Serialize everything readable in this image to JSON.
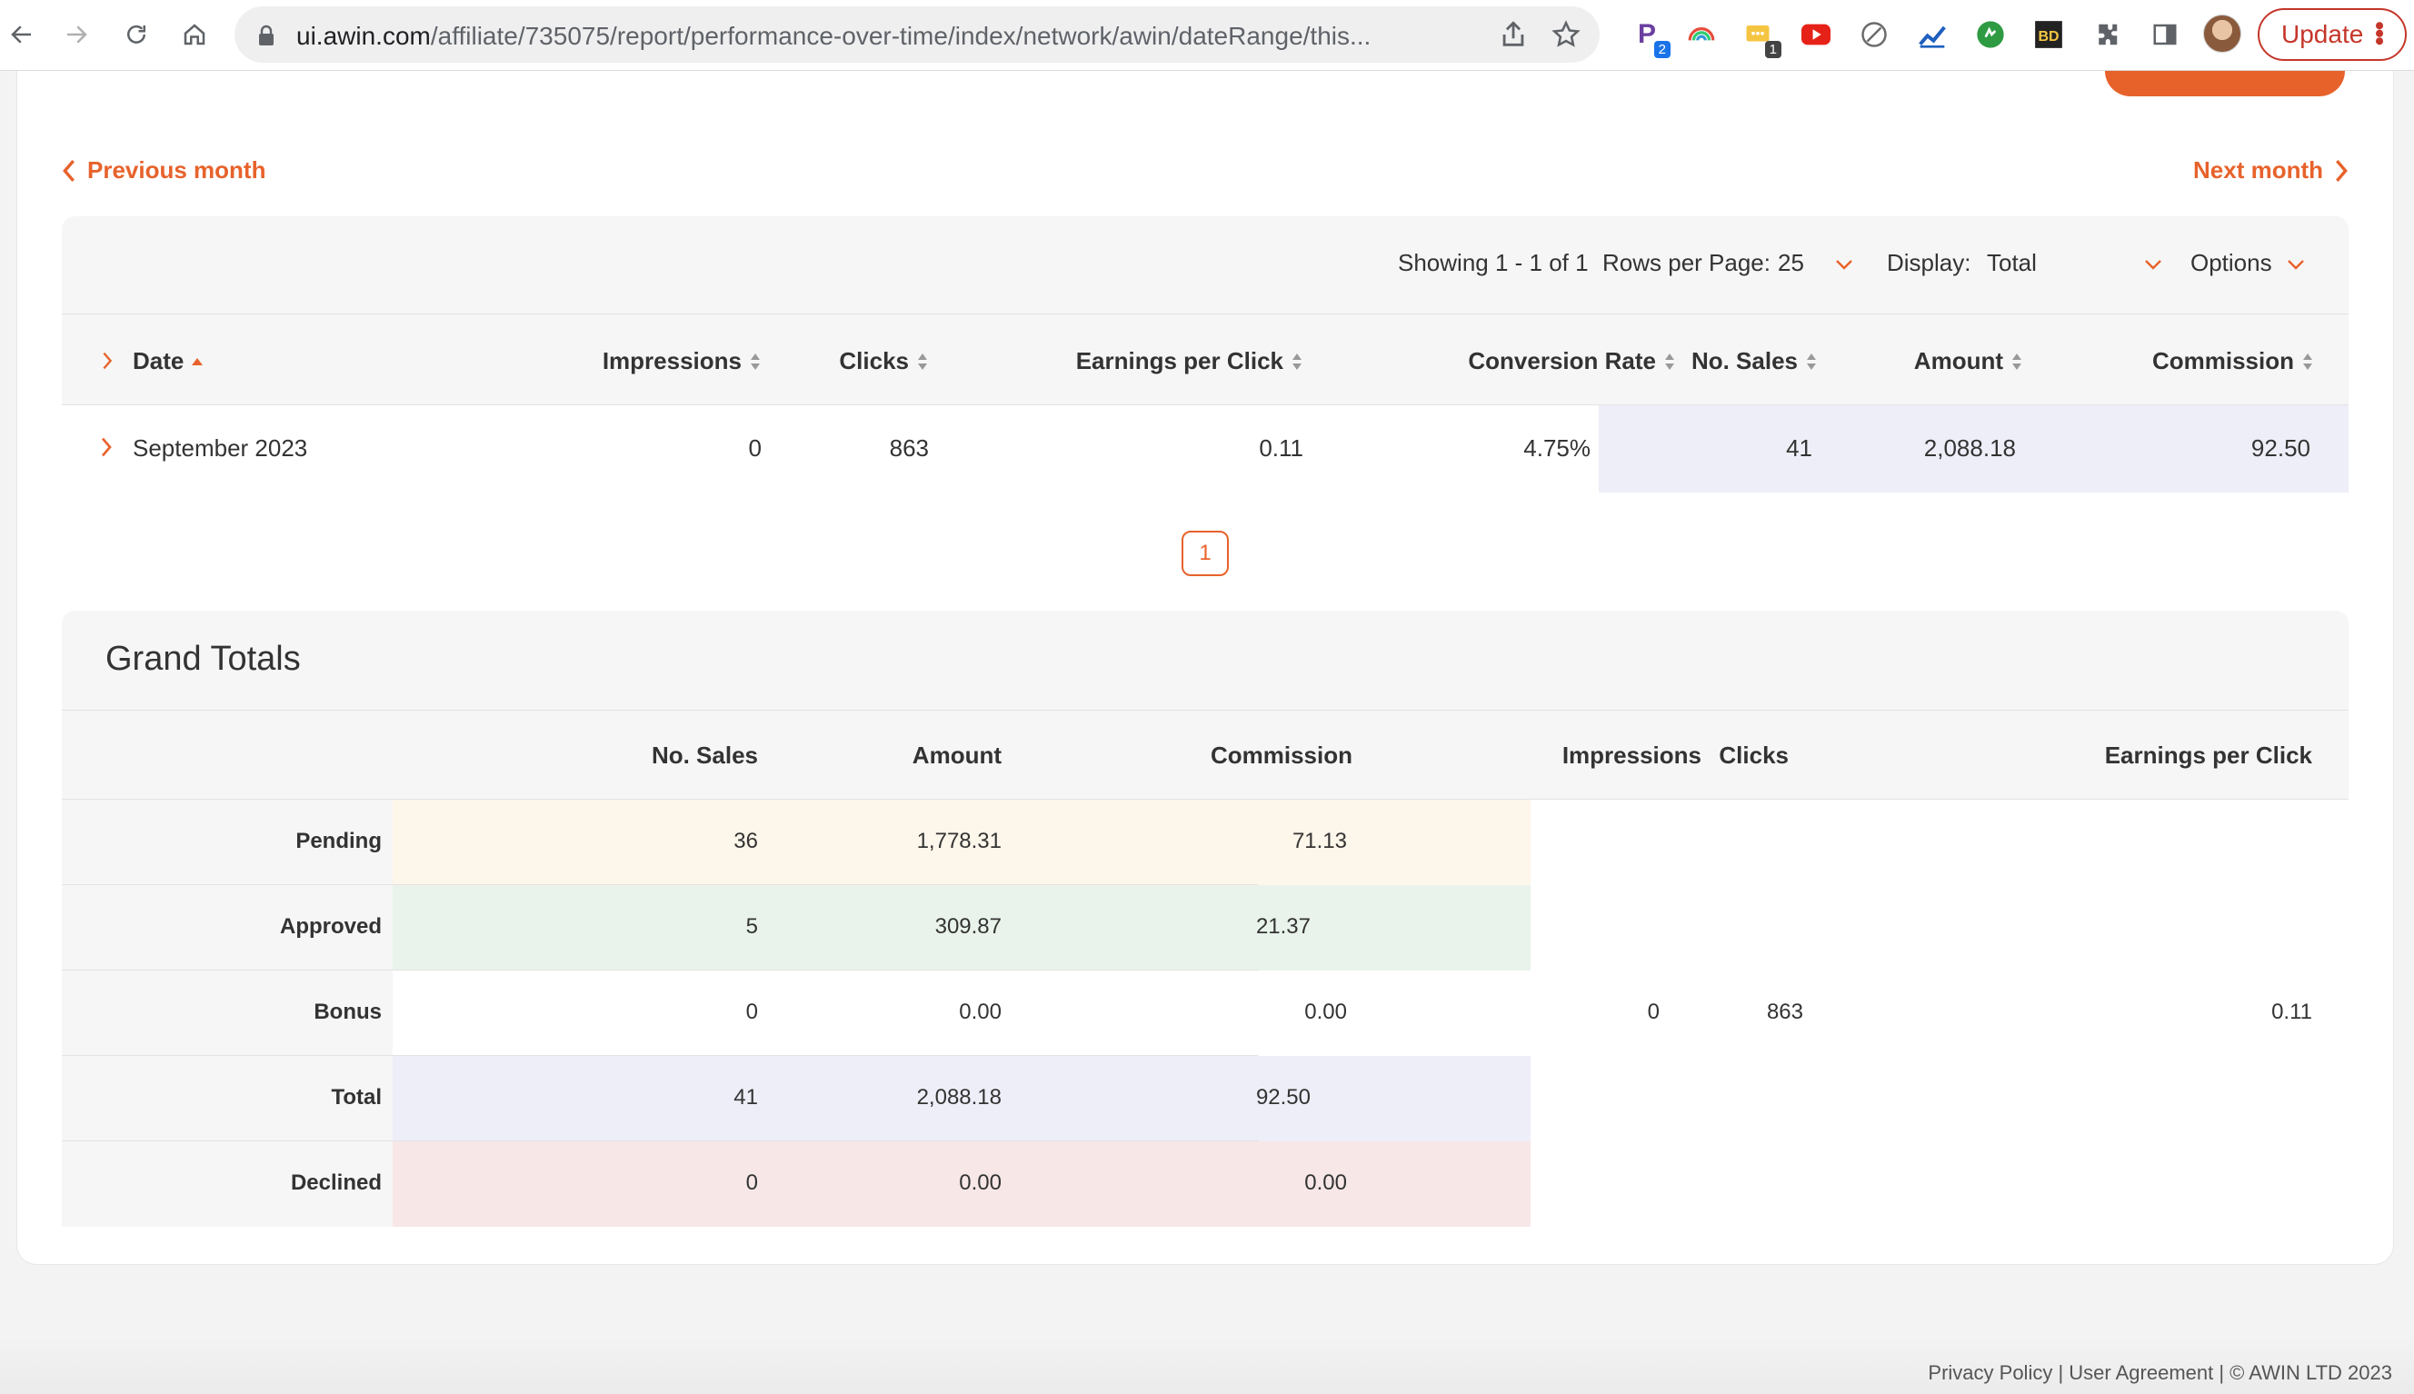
{
  "browser": {
    "url_host": "ui.awin.com",
    "url_path": "/affiliate/735075/report/performance-over-time/index/network/awin/dateRange/this...",
    "update_label": "Update",
    "extensions": [
      {
        "name": "p-extension-icon",
        "badge": "2"
      },
      {
        "name": "rainbow-extension-icon",
        "badge": ""
      },
      {
        "name": "chat-extension-icon",
        "badge": "1"
      },
      {
        "name": "youtube-extension-icon",
        "badge": ""
      },
      {
        "name": "blocked-extension-icon",
        "badge": ""
      },
      {
        "name": "chart-extension-icon",
        "badge": ""
      },
      {
        "name": "green-extension-icon",
        "badge": ""
      },
      {
        "name": "bd-extension-icon",
        "badge": ""
      }
    ]
  },
  "nav": {
    "previous_month": "Previous month",
    "next_month": "Next month"
  },
  "controls": {
    "showing": "Showing 1 - 1 of 1",
    "rows_per_page_label": "Rows per Page:",
    "rows_per_page_value": "25",
    "display_label": "Display:",
    "display_value": "Total",
    "options_label": "Options"
  },
  "report": {
    "columns": [
      "Date",
      "Impressions",
      "Clicks",
      "Earnings per Click",
      "Conversion Rate",
      "No. Sales",
      "Amount",
      "Commission"
    ],
    "rows": [
      {
        "date": "September 2023",
        "impressions": "0",
        "clicks": "863",
        "epc": "0.11",
        "conversion_rate": "4.75%",
        "sales": "41",
        "amount": "2,088.18",
        "commission": "92.50"
      }
    ]
  },
  "pagination": {
    "current_page": "1"
  },
  "grand_totals": {
    "title": "Grand Totals",
    "columns": [
      "No. Sales",
      "Amount",
      "Commission",
      "Impressions",
      "Clicks",
      "Earnings per Click"
    ],
    "rows": [
      {
        "label": "Pending",
        "sales": "36",
        "amount": "1,778.31",
        "commission": "71.13",
        "color": "#fdf6ea"
      },
      {
        "label": "Approved",
        "sales": "5",
        "amount": "309.87",
        "commission": "21.37",
        "color": "#e9f3eb"
      },
      {
        "label": "Bonus",
        "sales": "0",
        "amount": "0.00",
        "commission": "0.00",
        "color": "#ffffff",
        "impressions": "0",
        "clicks": "863",
        "epc": "0.11"
      },
      {
        "label": "Total",
        "sales": "41",
        "amount": "2,088.18",
        "commission": "92.50",
        "color": "#eeeef8"
      },
      {
        "label": "Declined",
        "sales": "0",
        "amount": "0.00",
        "commission": "0.00",
        "color": "#f8e7e7"
      }
    ]
  },
  "footer": {
    "text": "Privacy Policy | User Agreement | © AWIN LTD 2023"
  },
  "colors": {
    "accent": "#e7622b",
    "update": "#c5362a"
  }
}
